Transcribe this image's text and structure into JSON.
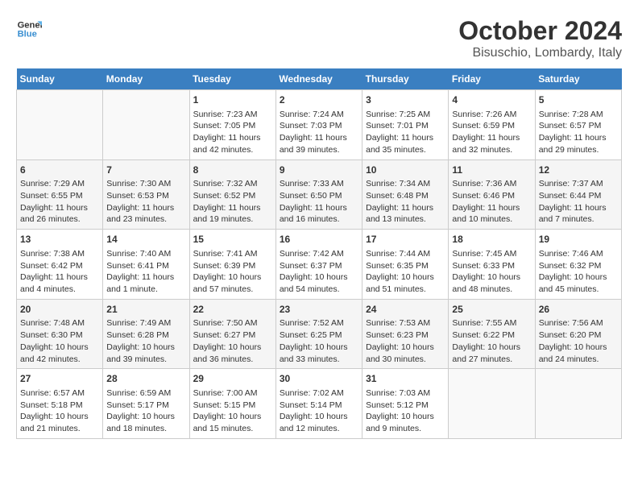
{
  "logo": {
    "line1": "General",
    "line2": "Blue"
  },
  "title": "October 2024",
  "subtitle": "Bisuschio, Lombardy, Italy",
  "weekdays": [
    "Sunday",
    "Monday",
    "Tuesday",
    "Wednesday",
    "Thursday",
    "Friday",
    "Saturday"
  ],
  "weeks": [
    [
      {
        "day": "",
        "info": ""
      },
      {
        "day": "",
        "info": ""
      },
      {
        "day": "1",
        "info": "Sunrise: 7:23 AM\nSunset: 7:05 PM\nDaylight: 11 hours and 42 minutes."
      },
      {
        "day": "2",
        "info": "Sunrise: 7:24 AM\nSunset: 7:03 PM\nDaylight: 11 hours and 39 minutes."
      },
      {
        "day": "3",
        "info": "Sunrise: 7:25 AM\nSunset: 7:01 PM\nDaylight: 11 hours and 35 minutes."
      },
      {
        "day": "4",
        "info": "Sunrise: 7:26 AM\nSunset: 6:59 PM\nDaylight: 11 hours and 32 minutes."
      },
      {
        "day": "5",
        "info": "Sunrise: 7:28 AM\nSunset: 6:57 PM\nDaylight: 11 hours and 29 minutes."
      }
    ],
    [
      {
        "day": "6",
        "info": "Sunrise: 7:29 AM\nSunset: 6:55 PM\nDaylight: 11 hours and 26 minutes."
      },
      {
        "day": "7",
        "info": "Sunrise: 7:30 AM\nSunset: 6:53 PM\nDaylight: 11 hours and 23 minutes."
      },
      {
        "day": "8",
        "info": "Sunrise: 7:32 AM\nSunset: 6:52 PM\nDaylight: 11 hours and 19 minutes."
      },
      {
        "day": "9",
        "info": "Sunrise: 7:33 AM\nSunset: 6:50 PM\nDaylight: 11 hours and 16 minutes."
      },
      {
        "day": "10",
        "info": "Sunrise: 7:34 AM\nSunset: 6:48 PM\nDaylight: 11 hours and 13 minutes."
      },
      {
        "day": "11",
        "info": "Sunrise: 7:36 AM\nSunset: 6:46 PM\nDaylight: 11 hours and 10 minutes."
      },
      {
        "day": "12",
        "info": "Sunrise: 7:37 AM\nSunset: 6:44 PM\nDaylight: 11 hours and 7 minutes."
      }
    ],
    [
      {
        "day": "13",
        "info": "Sunrise: 7:38 AM\nSunset: 6:42 PM\nDaylight: 11 hours and 4 minutes."
      },
      {
        "day": "14",
        "info": "Sunrise: 7:40 AM\nSunset: 6:41 PM\nDaylight: 11 hours and 1 minute."
      },
      {
        "day": "15",
        "info": "Sunrise: 7:41 AM\nSunset: 6:39 PM\nDaylight: 10 hours and 57 minutes."
      },
      {
        "day": "16",
        "info": "Sunrise: 7:42 AM\nSunset: 6:37 PM\nDaylight: 10 hours and 54 minutes."
      },
      {
        "day": "17",
        "info": "Sunrise: 7:44 AM\nSunset: 6:35 PM\nDaylight: 10 hours and 51 minutes."
      },
      {
        "day": "18",
        "info": "Sunrise: 7:45 AM\nSunset: 6:33 PM\nDaylight: 10 hours and 48 minutes."
      },
      {
        "day": "19",
        "info": "Sunrise: 7:46 AM\nSunset: 6:32 PM\nDaylight: 10 hours and 45 minutes."
      }
    ],
    [
      {
        "day": "20",
        "info": "Sunrise: 7:48 AM\nSunset: 6:30 PM\nDaylight: 10 hours and 42 minutes."
      },
      {
        "day": "21",
        "info": "Sunrise: 7:49 AM\nSunset: 6:28 PM\nDaylight: 10 hours and 39 minutes."
      },
      {
        "day": "22",
        "info": "Sunrise: 7:50 AM\nSunset: 6:27 PM\nDaylight: 10 hours and 36 minutes."
      },
      {
        "day": "23",
        "info": "Sunrise: 7:52 AM\nSunset: 6:25 PM\nDaylight: 10 hours and 33 minutes."
      },
      {
        "day": "24",
        "info": "Sunrise: 7:53 AM\nSunset: 6:23 PM\nDaylight: 10 hours and 30 minutes."
      },
      {
        "day": "25",
        "info": "Sunrise: 7:55 AM\nSunset: 6:22 PM\nDaylight: 10 hours and 27 minutes."
      },
      {
        "day": "26",
        "info": "Sunrise: 7:56 AM\nSunset: 6:20 PM\nDaylight: 10 hours and 24 minutes."
      }
    ],
    [
      {
        "day": "27",
        "info": "Sunrise: 6:57 AM\nSunset: 5:18 PM\nDaylight: 10 hours and 21 minutes."
      },
      {
        "day": "28",
        "info": "Sunrise: 6:59 AM\nSunset: 5:17 PM\nDaylight: 10 hours and 18 minutes."
      },
      {
        "day": "29",
        "info": "Sunrise: 7:00 AM\nSunset: 5:15 PM\nDaylight: 10 hours and 15 minutes."
      },
      {
        "day": "30",
        "info": "Sunrise: 7:02 AM\nSunset: 5:14 PM\nDaylight: 10 hours and 12 minutes."
      },
      {
        "day": "31",
        "info": "Sunrise: 7:03 AM\nSunset: 5:12 PM\nDaylight: 10 hours and 9 minutes."
      },
      {
        "day": "",
        "info": ""
      },
      {
        "day": "",
        "info": ""
      }
    ]
  ]
}
